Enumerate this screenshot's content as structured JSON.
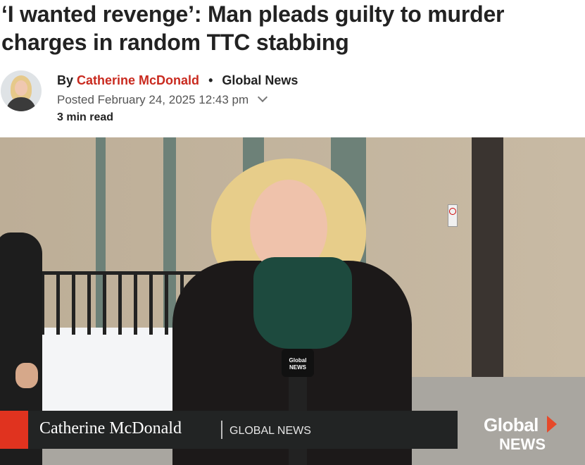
{
  "article": {
    "headline": "‘I wanted revenge’: Man pleads guilty to murder charges in random TTC stabbing"
  },
  "byline": {
    "by": "By",
    "author": "Catherine McDonald",
    "separator": "•",
    "outlet": "Global News",
    "posted": "Posted February 24, 2025 12:43 pm",
    "read_time": "3 min read"
  },
  "video": {
    "lower_third_name": "Catherine McDonald",
    "lower_third_org": "GLOBAL NEWS",
    "logo_top": "Global",
    "logo_bottom": "NEWS",
    "mic_flag_top": "Global",
    "mic_flag_bottom": "NEWS"
  },
  "colors": {
    "author_link": "#c92a1f",
    "lower_third_accent": "#e0331f"
  },
  "icons": {
    "posted_toggle": "chevron-down-icon"
  }
}
